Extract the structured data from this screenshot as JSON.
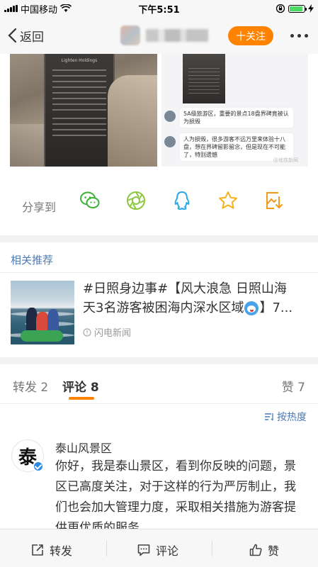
{
  "status_bar": {
    "carrier": "中国移动",
    "time": "下午5:51",
    "battery_level": 0.9
  },
  "nav": {
    "back_label": "返回",
    "follow_label": "十关注",
    "icons": [
      "chevron-left-icon",
      "more-icon"
    ]
  },
  "post": {
    "watermark": "@地铁新闻",
    "chat_messages": [
      "5A级旅游区，重要的景点18盘界碑竟被认为损毁",
      "人为损毁，很多游客不远万里来体验十八盘，想在界碑留影留念，但是现在不可能了，特别遗憾"
    ],
    "stele_caption": "Lighten Holdings"
  },
  "share": {
    "label": "分享到",
    "targets": [
      "wechat-icon",
      "moments-icon",
      "qq-icon",
      "favorite-star-icon",
      "save-image-icon"
    ]
  },
  "related": {
    "title": "相关推荐",
    "text_line1": "#日照身边事#【风大浪急 日照山海",
    "text_line2_a": "天3名游客被困海内深水区域",
    "text_line2_b": "】7...",
    "source": "闪电新闻"
  },
  "tabs": {
    "repost": "转发 2",
    "comment": "评论 8",
    "like": "赞 7"
  },
  "comments": {
    "sort_label": "按热度",
    "items": [
      {
        "name": "泰山风景区",
        "avatar_char": "泰",
        "text": "你好，我是泰山景区，看到你反映的问题，景区已高度关注，对于这样的行为严厉制止，我们也会加大管理力度，采取相关措施为游客提供更优质的服务。"
      }
    ]
  },
  "bottom_bar": {
    "repost": "转发",
    "comment": "评论",
    "like": "赞"
  },
  "colors": {
    "accent_orange": "#ff8200",
    "link_blue": "#4d7ab3",
    "verified_blue": "#2d8be3"
  }
}
